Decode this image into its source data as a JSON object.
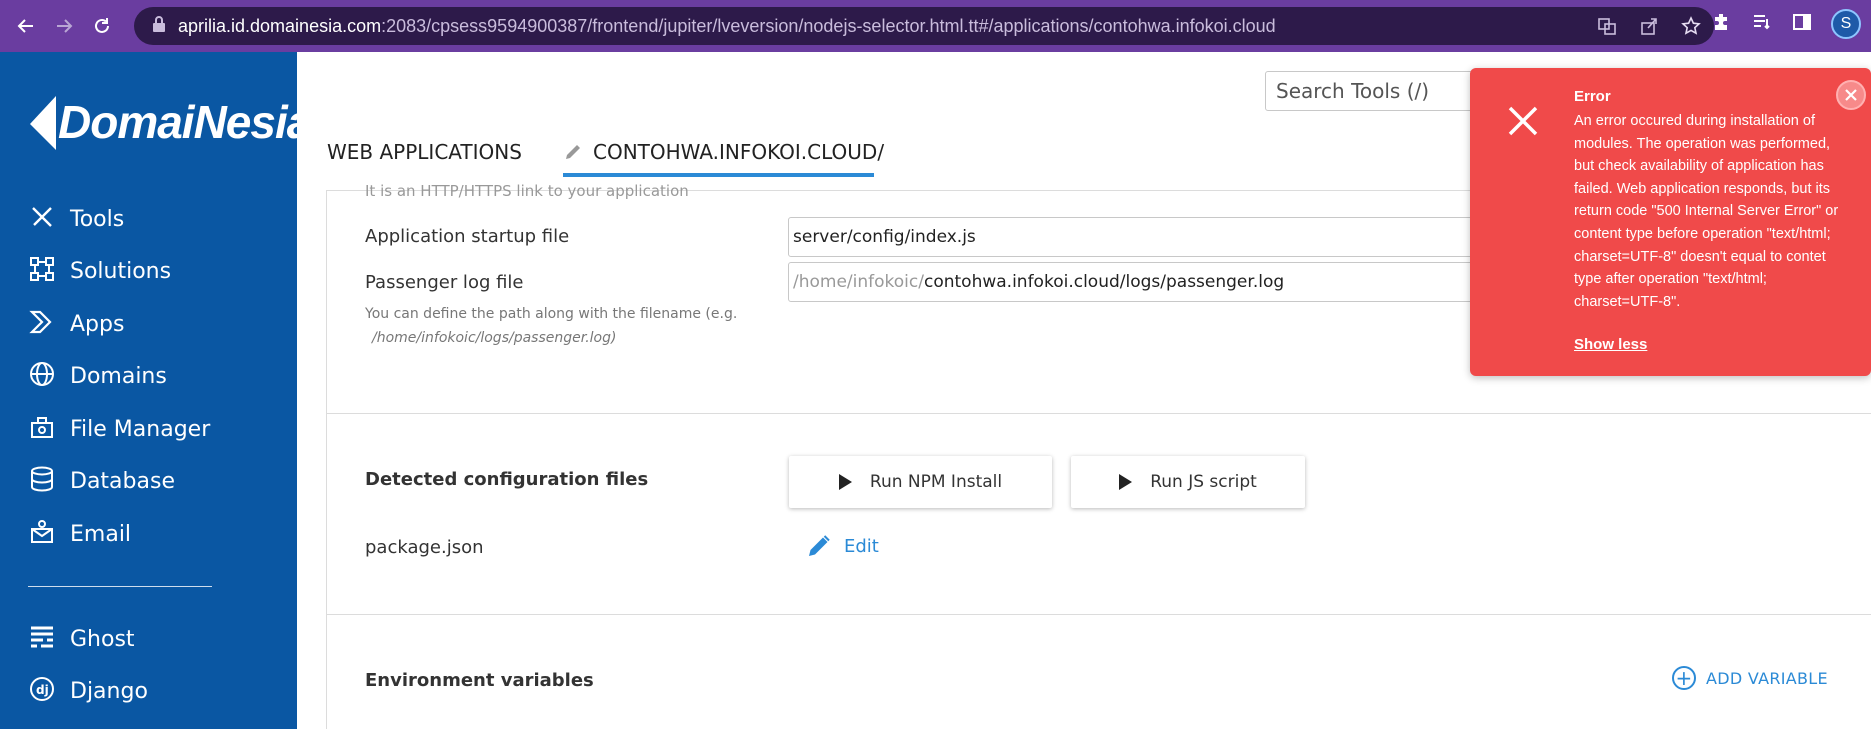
{
  "browser": {
    "url_host": "aprilia.id.domainesia.com",
    "url_rest": ":2083/cpsess9594900387/frontend/jupiter/lveversion/nodejs-selector.html.tt#/applications/contohwa.infokoi.cloud",
    "profile_initial": "S"
  },
  "sidebar": {
    "logo": "DomaiNesia",
    "items": [
      {
        "label": "Tools",
        "icon": "tools-icon"
      },
      {
        "label": "Solutions",
        "icon": "solutions-icon"
      },
      {
        "label": "Apps",
        "icon": "apps-icon"
      },
      {
        "label": "Domains",
        "icon": "globe-icon"
      },
      {
        "label": "File Manager",
        "icon": "file-manager-icon"
      },
      {
        "label": "Database",
        "icon": "database-icon"
      },
      {
        "label": "Email",
        "icon": "email-icon"
      },
      {
        "label": "Ghost",
        "icon": "ghost-icon"
      },
      {
        "label": "Django",
        "icon": "django-icon"
      }
    ]
  },
  "header": {
    "search_placeholder": "Search Tools (/)",
    "tab_web_apps": "WEB APPLICATIONS",
    "tab_app": "CONTOHWA.INFOKOI.CLOUD/"
  },
  "form": {
    "cut_hint": "It is an HTTP/HTTPS link to your application",
    "startup_label": "Application startup file",
    "startup_value": "server/config/index.js",
    "log_label": "Passenger log file",
    "log_prefix": "/home/infokoic/",
    "log_value": "contohwa.infokoi.cloud/logs/passenger.log",
    "log_help_1": "You can define the path along with the filename (e.g.",
    "log_help_2": "/home/infokoic/logs/passenger.log)"
  },
  "config": {
    "title": "Detected configuration files",
    "run_npm": "Run NPM Install",
    "run_js": "Run JS script",
    "package": "package.json",
    "edit": "Edit"
  },
  "env": {
    "title": "Environment variables",
    "add": "ADD VARIABLE"
  },
  "toast": {
    "title": "Error",
    "body": "An error occured during installation of modules. The operation was performed, but check availability of application has failed. Web application responds, but its return code \"500 Internal Server Error\" or content type before operation \"text/html; charset=UTF-8\" doesn't equal to contet type after operation \"text/html; charset=UTF-8\".",
    "link": "Show less",
    "color": "#f04a4a"
  },
  "colors": {
    "sidebar": "#0a57a3",
    "browser": "#6a3da0",
    "accent": "#2b8ad6"
  }
}
